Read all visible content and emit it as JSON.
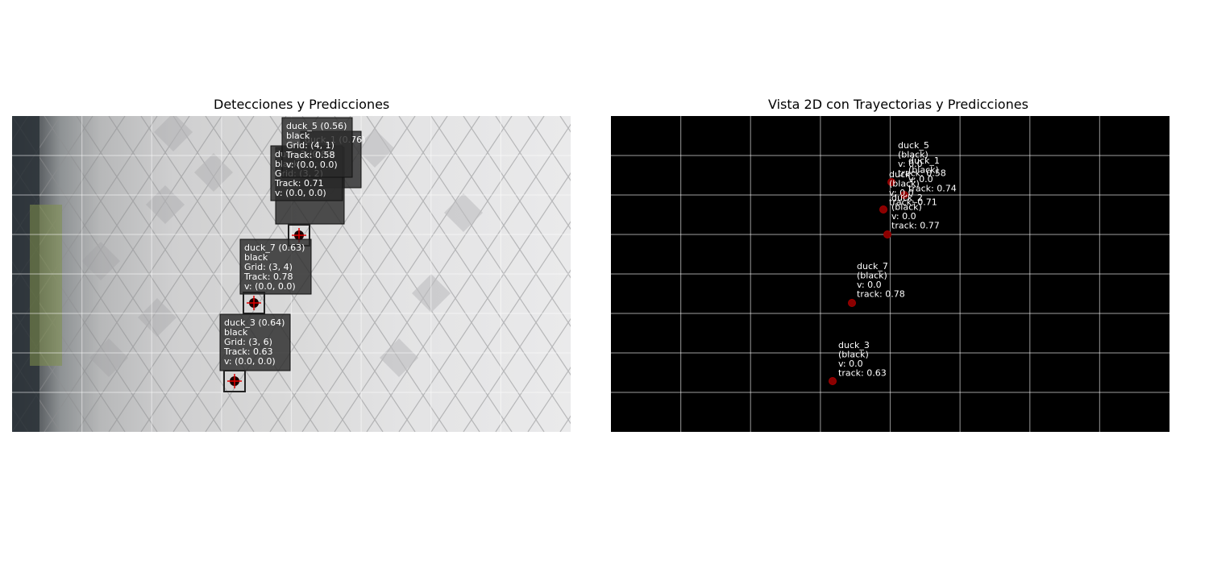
{
  "titles": {
    "left": "Detecciones y Predicciones",
    "right": "Vista 2D con Trayectorias y Predicciones"
  },
  "colors": {
    "left_bg": "#d8d8d8",
    "right_bg": "#000000",
    "grid": "#ffffff",
    "label_box": "#2b2b2b",
    "marker": "#8b0000"
  },
  "detections": [
    {
      "id": "duck_5",
      "lines": [
        "duck_5 (0.56)",
        "black",
        "Grid: (4, 1)",
        "Track: 0.58",
        "v: (0.0, 0.0)"
      ]
    },
    {
      "id": "duck_1",
      "lines": [
        "duck_1 (0.76)"
      ]
    },
    {
      "id": "duck_2",
      "lines": [
        "duck_2 (0.83)",
        "black",
        "Grid: (3, 2)",
        "Track: 0.71",
        "v: (0.0, 0.0)"
      ]
    },
    {
      "id": "duck_x",
      "lines": [
        "Track: 0.77",
        "v: (0.0, 0.0)"
      ]
    },
    {
      "id": "duck_7",
      "lines": [
        "duck_7 (0.63)",
        "black",
        "Grid: (3, 4)",
        "Track: 0.78",
        "v: (0.0, 0.0)"
      ]
    },
    {
      "id": "duck_3",
      "lines": [
        "duck_3 (0.64)",
        "black",
        "Grid: (3, 6)",
        "Track: 0.63",
        "v: (0.0, 0.0)"
      ]
    }
  ],
  "map_points": [
    {
      "id": "duck_5",
      "lines": [
        "duck_5",
        "(black)",
        "v: 0.0",
        "track: 0.58"
      ]
    },
    {
      "id": "duck_1",
      "lines": [
        "duck_1",
        "(black)",
        "v: 0.0",
        "track: 0.74"
      ]
    },
    {
      "id": "duck_x",
      "lines": [
        "duck_",
        "(black)",
        "v: 0.0",
        "track: 0.71"
      ]
    },
    {
      "id": "duck_2",
      "lines": [
        "duck_2",
        "(black)",
        "v: 0.0",
        "track: 0.77"
      ]
    },
    {
      "id": "duck_7",
      "lines": [
        "duck_7",
        "(black)",
        "v: 0.0",
        "track: 0.78"
      ]
    },
    {
      "id": "duck_3",
      "lines": [
        "duck_3",
        "(black)",
        "v: 0.0",
        "track: 0.63"
      ]
    }
  ]
}
